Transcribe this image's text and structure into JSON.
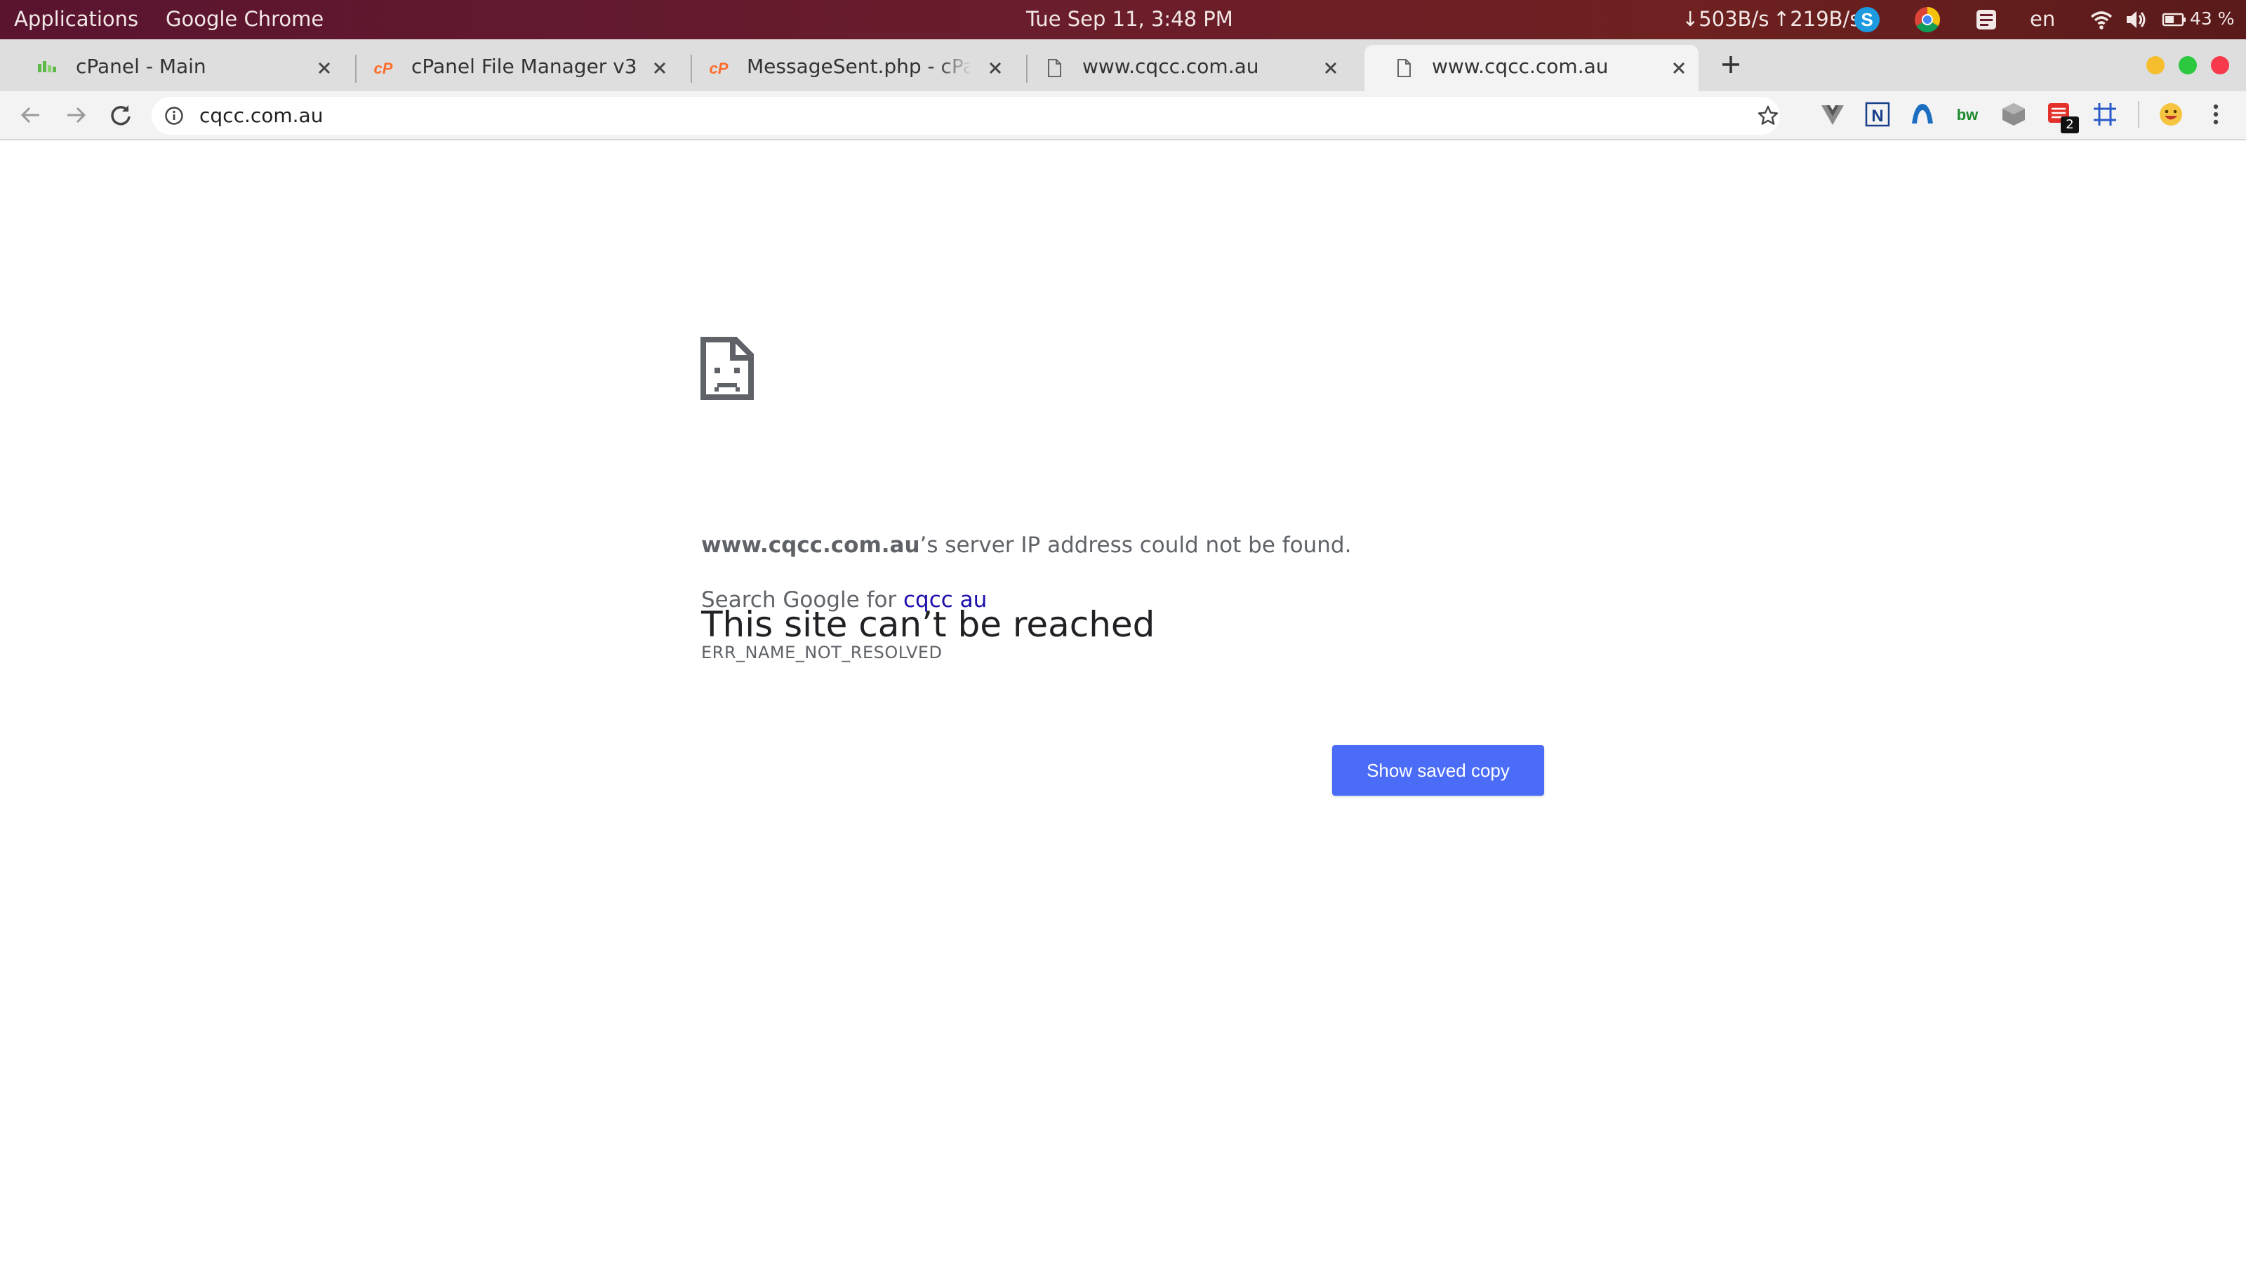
{
  "system_bar": {
    "applications": "Applications",
    "active_app": "Google Chrome",
    "clock": "Tue Sep 11,  3:48 PM",
    "network_down": "↓503B/s",
    "network_up": "↑219B/s",
    "keyboard_layout": "en",
    "battery": "43 %",
    "tray_icons": [
      "skype-icon",
      "chrome-icon",
      "tray-app-icon",
      "wifi-icon",
      "volume-icon",
      "battery-icon"
    ]
  },
  "tabs": [
    {
      "title": "cPanel - Main",
      "favicon": "cpanel-main-favicon"
    },
    {
      "title": "cPanel File Manager v3",
      "favicon": "cpanel-favicon"
    },
    {
      "title": "MessageSent.php - cPane",
      "favicon": "cpanel-favicon"
    },
    {
      "title": "www.cqcc.com.au",
      "favicon": "page-icon"
    },
    {
      "title": "www.cqcc.com.au",
      "favicon": "page-icon",
      "active": true
    }
  ],
  "toolbar": {
    "url": "cqcc.com.au",
    "extension_badge": "2",
    "extensions": [
      "vue-devtools-icon",
      "extension-n-icon",
      "extension-arc-icon",
      "bw-icon",
      "extension-cube-icon",
      "todoist-icon",
      "extension-grid-icon",
      "emoji-icon"
    ]
  },
  "error_page": {
    "heading": "This site can’t be reached",
    "host": "www.cqcc.com.au",
    "message_suffix": "’s server IP address could not be found.",
    "search_prefix": "Search Google for ",
    "search_link": "cqcc au",
    "error_code": "ERR_NAME_NOT_RESOLVED",
    "button_label": "Show saved copy"
  },
  "colors": {
    "button": "#4a6cf7",
    "link": "#1a0dab",
    "window_minimize": "#f6be2c",
    "window_maximize": "#2bc840",
    "window_close": "#f73a4b"
  }
}
